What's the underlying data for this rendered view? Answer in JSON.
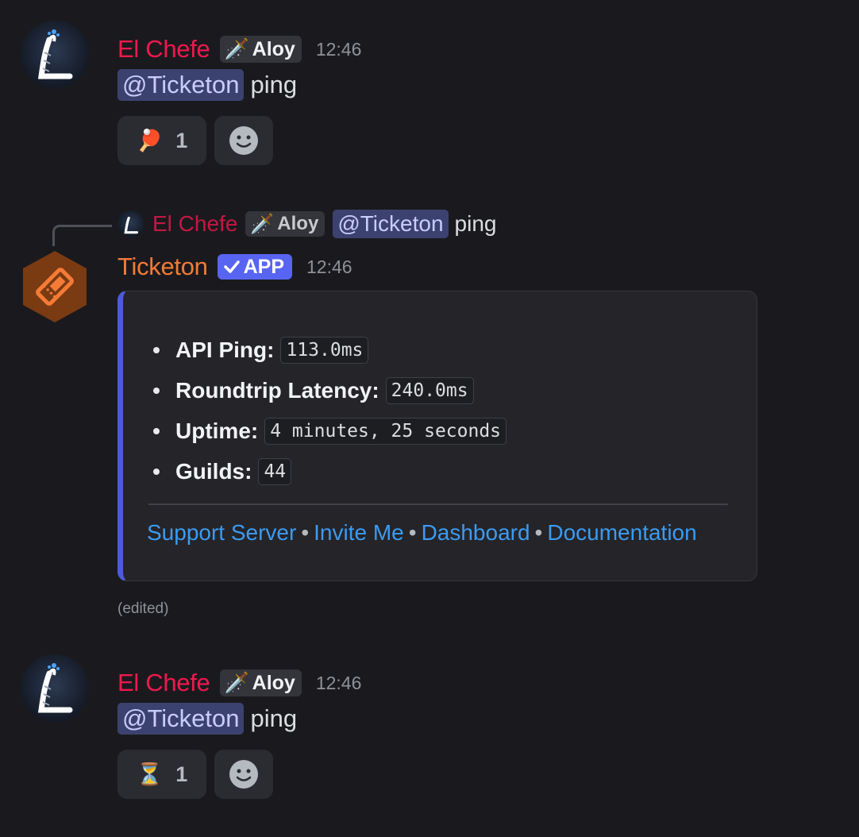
{
  "messages": [
    {
      "author": "El Chefe",
      "tag": "Aloy",
      "time": "12:46",
      "mention": "@Ticketon",
      "text": "ping",
      "reactions": [
        {
          "emoji": "🏓",
          "icon": "ping-pong-icon",
          "count": "1"
        }
      ]
    },
    {
      "author": "El Chefe",
      "tag": "Aloy",
      "time": "12:46",
      "mention": "@Ticketon",
      "text": "ping",
      "reactions": [
        {
          "emoji": "⏳",
          "icon": "hourglass-icon",
          "count": "1"
        }
      ]
    }
  ],
  "reply": {
    "author": "El Chefe",
    "tag": "Aloy",
    "mention": "@Ticketon",
    "text": "ping"
  },
  "bot": {
    "name": "Ticketon",
    "badge": "APP",
    "time": "12:46",
    "edited": "(edited)",
    "embed": {
      "fields": [
        {
          "label": "API Ping:",
          "value": "113.0ms"
        },
        {
          "label": "Roundtrip Latency:",
          "value": "240.0ms"
        },
        {
          "label": "Uptime:",
          "value": "4 minutes, 25 seconds"
        },
        {
          "label": "Guilds:",
          "value": "44"
        }
      ],
      "links": [
        "Support Server",
        "Invite Me",
        "Dashboard",
        "Documentation"
      ],
      "separator": "•",
      "accent_color": "#4f5bd5"
    }
  },
  "colors": {
    "background": "#1a1a1e",
    "author_color": "#f0184d",
    "bot_color": "#f47b36",
    "link_color": "#3c9bf1",
    "mention_bg": "#3c4270"
  }
}
